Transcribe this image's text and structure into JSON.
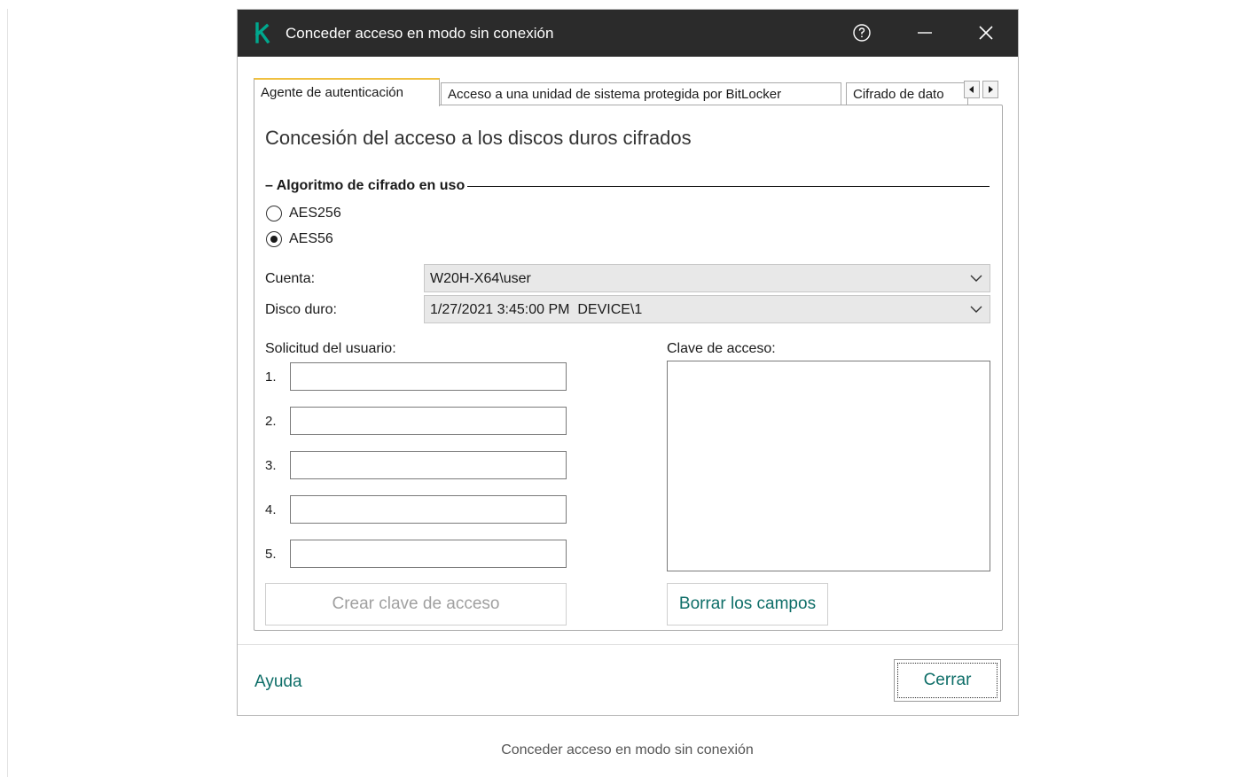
{
  "window": {
    "title": "Conceder acceso en modo sin conexión"
  },
  "tabs": [
    {
      "label": "Agente de autenticación",
      "active": true
    },
    {
      "label": "Acceso a una unidad de sistema protegida por BitLocker",
      "active": false
    },
    {
      "label": "Cifrado de dato",
      "active": false
    }
  ],
  "panel": {
    "heading": "Concesión del acceso a los discos duros cifrados",
    "algorithm_group": "Algoritmo de cifrado en uso",
    "radios": [
      {
        "label": "AES256",
        "selected": false
      },
      {
        "label": "AES56",
        "selected": true
      }
    ],
    "account": {
      "label": "Cuenta:",
      "value": "W20H-X64\\user"
    },
    "disk": {
      "label": "Disco duro:",
      "value": "1/27/2021 3:45:00 PM  DEVICE\\1"
    },
    "user_request_label": "Solicitud del usuario:",
    "request_rows": [
      "1.",
      "2.",
      "3.",
      "4.",
      "5."
    ],
    "access_key_label": "Clave de acceso:",
    "create_key_button": "Crear clave de acceso",
    "clear_fields_button": "Borrar los campos"
  },
  "footer": {
    "help": "Ayuda",
    "close": "Cerrar"
  },
  "caption": "Conceder acceso en modo sin conexión",
  "colors": {
    "titlebar": "#2b2b2b",
    "accent": "#0e6e68",
    "logo": "#00a88e",
    "active_tab_marker": "#f0c040"
  }
}
